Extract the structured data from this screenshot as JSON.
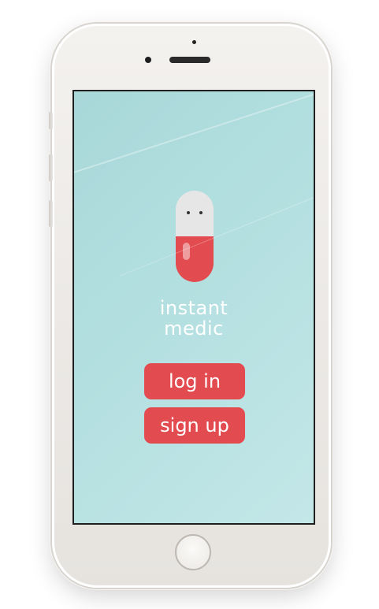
{
  "app": {
    "name_line1": "instant",
    "name_line2": "medic"
  },
  "buttons": {
    "login_label": "log in",
    "signup_label": "sign up"
  },
  "colors": {
    "screen_background": "#b3dfe0",
    "accent_red": "#e24b4f",
    "pill_top": "#e6e6e6",
    "text": "#ffffff",
    "phone_body": "#eeebe8"
  },
  "icons": {
    "logo": "pill-mascot-icon",
    "home": "home-button-icon",
    "camera": "front-camera-icon",
    "speaker": "earpiece-speaker-icon"
  }
}
